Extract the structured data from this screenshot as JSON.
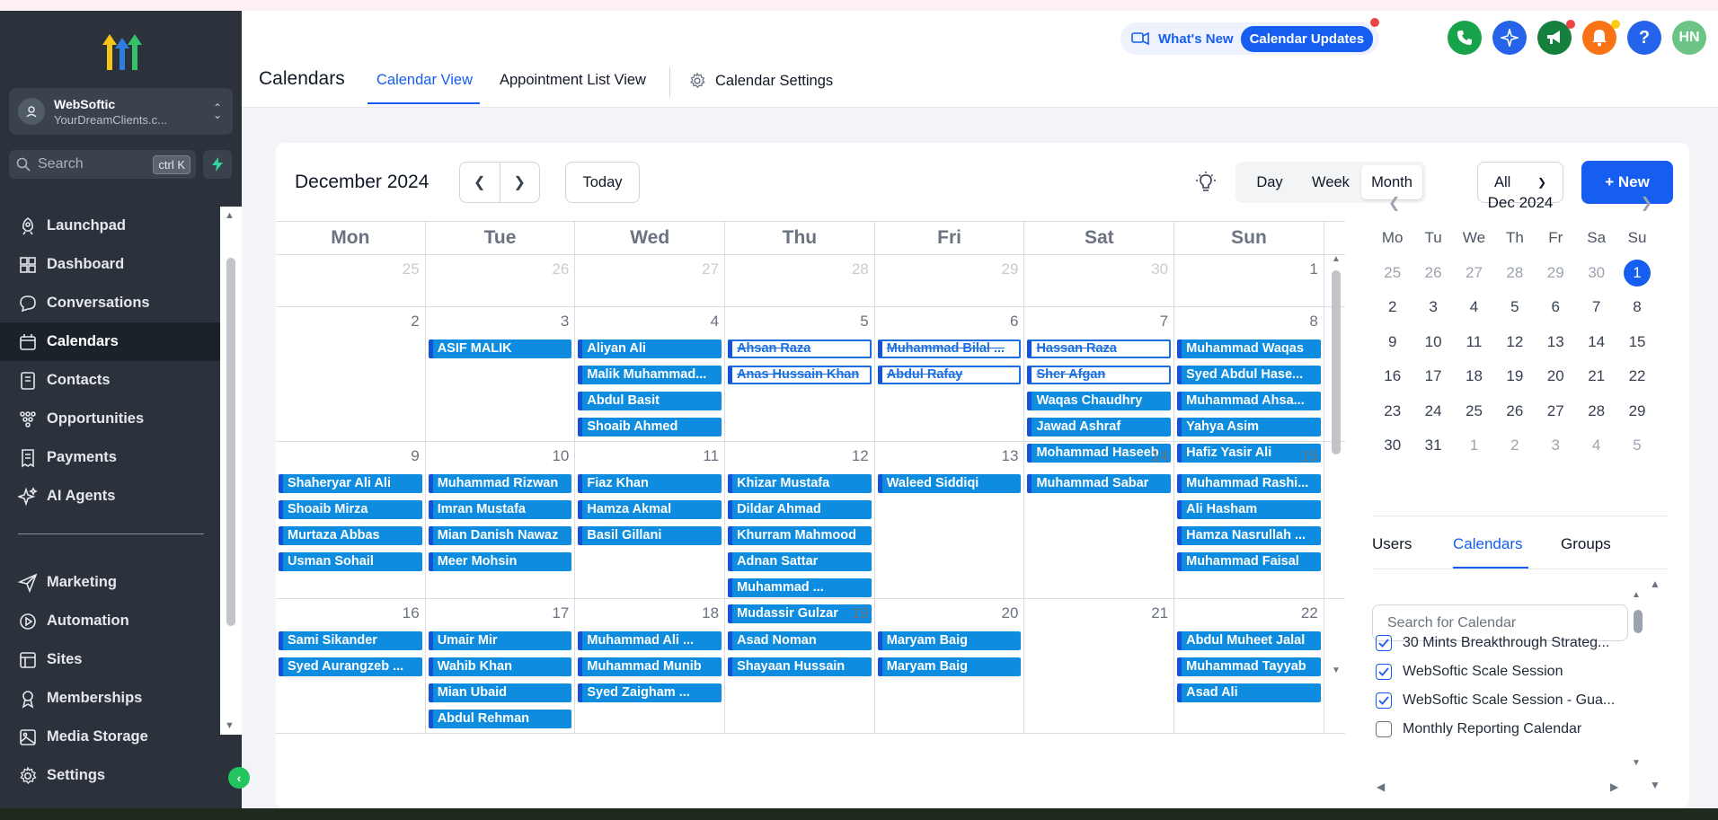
{
  "sidebar": {
    "account_name": "WebSoftic",
    "account_sub": "YourDreamClients.c...",
    "search_placeholder": "Search",
    "search_shortcut": "ctrl K",
    "items": [
      {
        "label": "Launchpad",
        "icon": "rocket-icon"
      },
      {
        "label": "Dashboard",
        "icon": "grid-icon"
      },
      {
        "label": "Conversations",
        "icon": "chat-icon"
      },
      {
        "label": "Calendars",
        "icon": "calendar-icon",
        "active": true
      },
      {
        "label": "Contacts",
        "icon": "contact-book-icon"
      },
      {
        "label": "Opportunities",
        "icon": "funnel-icon"
      },
      {
        "label": "Payments",
        "icon": "receipt-icon"
      },
      {
        "label": "AI Agents",
        "icon": "sparkle-icon"
      }
    ],
    "items2": [
      {
        "label": "Marketing",
        "icon": "send-icon"
      },
      {
        "label": "Automation",
        "icon": "play-circle-icon"
      },
      {
        "label": "Sites",
        "icon": "sites-icon"
      },
      {
        "label": "Memberships",
        "icon": "medal-icon"
      },
      {
        "label": "Media Storage",
        "icon": "image-icon"
      }
    ],
    "settings_label": "Settings"
  },
  "header": {
    "page_title": "Calendars",
    "tabs": [
      "Calendar View",
      "Appointment List View",
      "Calendar Settings"
    ],
    "whats_new": "What's New",
    "calendar_updates": "Calendar Updates",
    "avatar_initials": "HN"
  },
  "toolbar": {
    "month_title": "December 2024",
    "today": "Today",
    "views": [
      "Day",
      "Week",
      "Month"
    ],
    "active_view": "Month",
    "filter": "All",
    "new": "+ New"
  },
  "grid": {
    "weekdays": [
      "Mon",
      "Tue",
      "Wed",
      "Thu",
      "Fri",
      "Sat",
      "Sun"
    ],
    "weeks": [
      {
        "days": [
          {
            "n": "25",
            "out": true,
            "events": []
          },
          {
            "n": "26",
            "out": true,
            "events": []
          },
          {
            "n": "27",
            "out": true,
            "events": []
          },
          {
            "n": "28",
            "out": true,
            "events": []
          },
          {
            "n": "29",
            "out": true,
            "events": []
          },
          {
            "n": "30",
            "out": true,
            "events": []
          },
          {
            "n": "1",
            "events": []
          }
        ]
      },
      {
        "days": [
          {
            "n": "2",
            "events": []
          },
          {
            "n": "3",
            "events": [
              {
                "t": "ASIF MALIK"
              }
            ]
          },
          {
            "n": "4",
            "events": [
              {
                "t": "Aliyan Ali"
              },
              {
                "t": "Malik Muhammad..."
              },
              {
                "t": "Abdul Basit"
              },
              {
                "t": "Shoaib Ahmed"
              }
            ]
          },
          {
            "n": "5",
            "events": [
              {
                "t": "Ahsan Raza",
                "c": true
              },
              {
                "t": "Anas Hussain Khan",
                "c": true
              }
            ]
          },
          {
            "n": "6",
            "events": [
              {
                "t": "Muhammad Bilal ...",
                "c": true
              },
              {
                "t": "Abdul Rafay",
                "c": true
              }
            ]
          },
          {
            "n": "7",
            "events": [
              {
                "t": "Hassan Raza",
                "c": true
              },
              {
                "t": "Sher Afgan",
                "c": true
              },
              {
                "t": "Waqas Chaudhry"
              },
              {
                "t": "Jawad Ashraf"
              },
              {
                "t": "Mohammad Haseeb"
              }
            ]
          },
          {
            "n": "8",
            "events": [
              {
                "t": "Muhammad Waqas"
              },
              {
                "t": "Syed Abdul Hase..."
              },
              {
                "t": "Muhammad Ahsa..."
              },
              {
                "t": "Yahya Asim"
              },
              {
                "t": "Hafiz Yasir Ali"
              }
            ]
          }
        ]
      },
      {
        "days": [
          {
            "n": "9",
            "events": [
              {
                "t": "Shaheryar Ali Ali"
              },
              {
                "t": "Shoaib Mirza"
              },
              {
                "t": "Murtaza Abbas"
              },
              {
                "t": "Usman Sohail"
              }
            ]
          },
          {
            "n": "10",
            "events": [
              {
                "t": "Muhammad Rizwan"
              },
              {
                "t": "Imran Mustafa"
              },
              {
                "t": "Mian Danish Nawaz"
              },
              {
                "t": "Meer Mohsin"
              }
            ]
          },
          {
            "n": "11",
            "events": [
              {
                "t": "Fiaz Khan"
              },
              {
                "t": "Hamza Akmal"
              },
              {
                "t": "Basil Gillani"
              }
            ]
          },
          {
            "n": "12",
            "events": [
              {
                "t": "Khizar Mustafa"
              },
              {
                "t": "Dildar Ahmad"
              },
              {
                "t": "Khurram Mahmood"
              },
              {
                "t": "Adnan Sattar"
              },
              {
                "t": "Muhammad ..."
              },
              {
                "t": "Mudassir Gulzar"
              }
            ]
          },
          {
            "n": "13",
            "events": [
              {
                "t": "Waleed Siddiqi"
              }
            ]
          },
          {
            "n": "14",
            "events": [
              {
                "t": "Muhammad Sabar"
              }
            ]
          },
          {
            "n": "15",
            "events": [
              {
                "t": "Muhammad Rashi..."
              },
              {
                "t": "Ali Hasham"
              },
              {
                "t": "Hamza Nasrullah ..."
              },
              {
                "t": "Muhammad Faisal"
              }
            ]
          }
        ]
      },
      {
        "days": [
          {
            "n": "16",
            "events": [
              {
                "t": "Sami Sikander"
              },
              {
                "t": "Syed Aurangzeb ..."
              }
            ]
          },
          {
            "n": "17",
            "events": [
              {
                "t": "Umair Mir"
              },
              {
                "t": "Wahib Khan"
              },
              {
                "t": "Mian Ubaid"
              },
              {
                "t": "Abdul Rehman"
              }
            ]
          },
          {
            "n": "18",
            "events": [
              {
                "t": "Muhammad Ali ..."
              },
              {
                "t": "Muhammad Munib"
              },
              {
                "t": "Syed Zaigham ..."
              }
            ]
          },
          {
            "n": "19",
            "events": [
              {
                "t": "Asad Noman"
              },
              {
                "t": "Shayaan Hussain"
              }
            ]
          },
          {
            "n": "20",
            "events": [
              {
                "t": "Maryam Baig"
              },
              {
                "t": "Maryam Baig"
              }
            ]
          },
          {
            "n": "21",
            "events": []
          },
          {
            "n": "22",
            "events": [
              {
                "t": "Abdul Muheet Jalal"
              },
              {
                "t": "Muhammad Tayyab"
              },
              {
                "t": "Asad Ali"
              }
            ]
          }
        ]
      }
    ]
  },
  "mini": {
    "title": "Dec 2024",
    "dow": [
      "Mo",
      "Tu",
      "We",
      "Th",
      "Fr",
      "Sa",
      "Su"
    ],
    "rows": [
      [
        [
          "25",
          1
        ],
        [
          "26",
          1
        ],
        [
          "27",
          1
        ],
        [
          "28",
          1
        ],
        [
          "29",
          1
        ],
        [
          "30",
          1
        ],
        [
          "1",
          2
        ]
      ],
      [
        [
          "2",
          0
        ],
        [
          "3",
          0
        ],
        [
          "4",
          0
        ],
        [
          "5",
          0
        ],
        [
          "6",
          0
        ],
        [
          "7",
          0
        ],
        [
          "8",
          0
        ]
      ],
      [
        [
          "9",
          0
        ],
        [
          "10",
          0
        ],
        [
          "11",
          0
        ],
        [
          "12",
          0
        ],
        [
          "13",
          0
        ],
        [
          "14",
          0
        ],
        [
          "15",
          0
        ]
      ],
      [
        [
          "16",
          0
        ],
        [
          "17",
          0
        ],
        [
          "18",
          0
        ],
        [
          "19",
          0
        ],
        [
          "20",
          0
        ],
        [
          "21",
          0
        ],
        [
          "22",
          0
        ]
      ],
      [
        [
          "23",
          0
        ],
        [
          "24",
          0
        ],
        [
          "25",
          0
        ],
        [
          "26",
          0
        ],
        [
          "27",
          0
        ],
        [
          "28",
          0
        ],
        [
          "29",
          0
        ]
      ],
      [
        [
          "30",
          0
        ],
        [
          "31",
          0
        ],
        [
          "1",
          1
        ],
        [
          "2",
          1
        ],
        [
          "3",
          1
        ],
        [
          "4",
          1
        ],
        [
          "5",
          1
        ]
      ]
    ]
  },
  "filters": {
    "tabs": [
      "Users",
      "Calendars",
      "Groups"
    ],
    "active_tab": "Calendars",
    "search_placeholder": "Search for Calendar",
    "calendars": [
      {
        "label": "30 Mints Breakthrough Strateg...",
        "checked": true
      },
      {
        "label": "WebSoftic Scale Session",
        "checked": true
      },
      {
        "label": "WebSoftic Scale Session - Gua...",
        "checked": true
      },
      {
        "label": "Monthly Reporting Calendar",
        "checked": false
      }
    ]
  },
  "colors": {
    "accent": "#155eef",
    "event_fill": "#0e8ce0",
    "sidebar_bg": "#2b323c"
  }
}
